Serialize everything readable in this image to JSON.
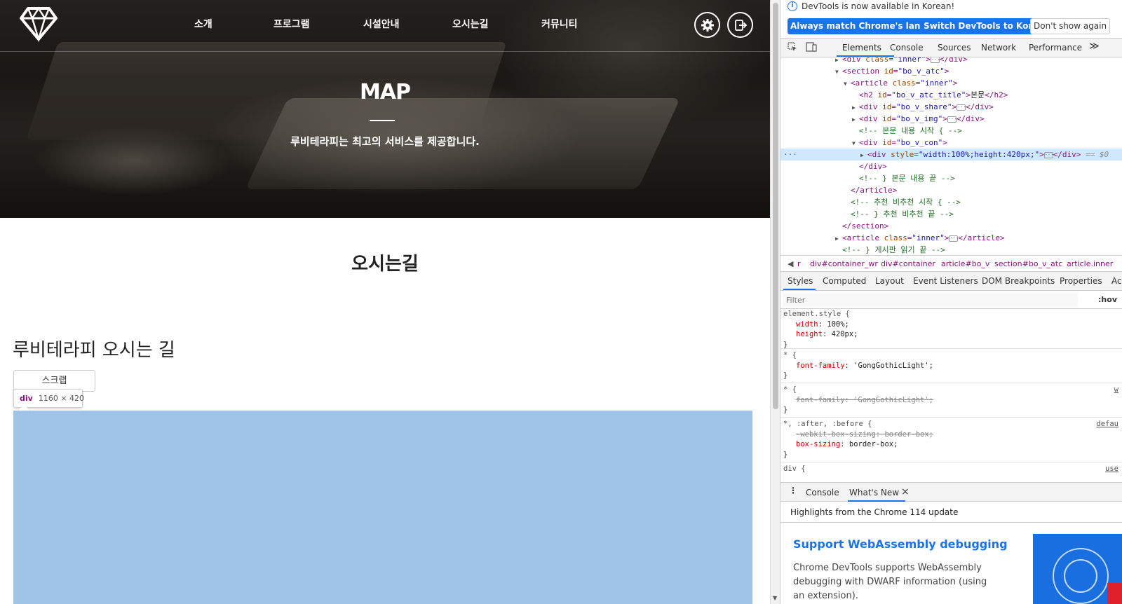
{
  "site": {
    "nav_items": [
      "소개",
      "프로그램",
      "시설안내",
      "오시는길",
      "커뮤니티"
    ],
    "hero_title": "MAP",
    "hero_subtitle": "루비테라피는 최고의 서비스를 제공합니다.",
    "page_title": "오시는길",
    "post_title": "루비테라피 오시는 길",
    "scrap_button": "스크랩",
    "tooltip_tag": "div",
    "tooltip_dims": "1160 × 420",
    "map_color": "#a0c4e7"
  },
  "devtools": {
    "infobar_message": "DevTools is now available in Korean!",
    "btn_match_language": "Always match Chrome's language",
    "btn_switch_korean": "Switch DevTools to Korean",
    "btn_dont_show": "Don't show again",
    "tabs": [
      "Elements",
      "Console",
      "Sources",
      "Network",
      "Performance"
    ],
    "more_tabs": "≫",
    "dom": {
      "l1_attr": "class",
      "l1_val": "\"inner\"",
      "l2_val": "\"bo_v_atc\"",
      "l3_val": "\"inner\"",
      "l4_val": "\"bo_v_atc_title\"",
      "l4_text": "본문",
      "l5_val": "\"bo_v_share\"",
      "l6_val": "\"bo_v_img\"",
      "l7_comment": "<!-- 본문 내용 시작 { -->",
      "l8_val": "\"bo_v_con\"",
      "l9_attr": "style",
      "l9_val": "\"width:100%;height:420px;\"",
      "l9_eq": "== $0",
      "l10_close": "</div>",
      "l11_comment": "<!-- } 본문 내용 끝 -->",
      "l12_close": "</article>",
      "l13_comment": "<!--  추천 비추천 시작 { -->",
      "l14_comment": "<!-- }  추천 비추천 끝 -->",
      "l15_close": "</section>",
      "l16_val": "\"inner\"",
      "l17_comment": "<!-- } 게시판 읽기 끝 -->"
    },
    "breadcrumbs": [
      "r",
      "div#container_wr",
      "div#container",
      "article#bo_v",
      "section#bo_v_atc",
      "article.inner"
    ],
    "styles_tabs": [
      "Styles",
      "Computed",
      "Layout",
      "Event Listeners",
      "DOM Breakpoints",
      "Properties",
      "Ac"
    ],
    "filter_placeholder": "Filter",
    "hov": ":hov",
    "rules": {
      "r1_selector": "element.style {",
      "r1_d1_name": "width",
      "r1_d1_val": "100%;",
      "r1_d2_name": "height",
      "r1_d2_val": "420px;",
      "r2_selector": "* {",
      "r2_d1_name": "font-family",
      "r2_d1_val": "'GongGothicLight';",
      "r3_selector": "* {",
      "r3_src": "w",
      "r3_d1_name": "font-family",
      "r3_d1_val": "'GongGothicLight';",
      "r4_selector": "*, :after, :before {",
      "r4_src": "defau",
      "r4_d1_name": "-webkit-box-sizing",
      "r4_d1_val": "border-box;",
      "r4_d2_name": "box-sizing",
      "r4_d2_val": "border-box;",
      "r5_selector": "div {",
      "r5_src": "use",
      "close_brace": "}"
    },
    "drawer_tabs": [
      "Console",
      "What's New"
    ],
    "drawer_close": "×",
    "highlights": "Highlights from the Chrome 114 update",
    "whats_new_title": "Support WebAssembly debugging",
    "whats_new_body": "Chrome DevTools supports WebAssembly debugging with DWARF information (using an extension)."
  }
}
